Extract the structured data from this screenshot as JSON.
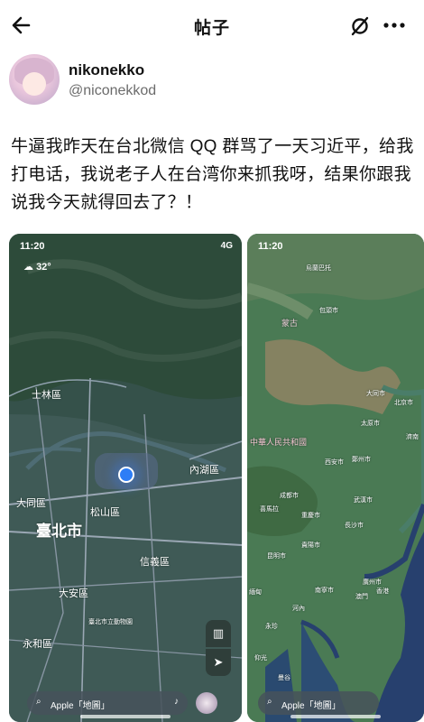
{
  "header": {
    "title": "帖子",
    "back_icon": "back-arrow-icon",
    "mute_icon": "mute-icon",
    "more_icon": "more-icon"
  },
  "author": {
    "name": "nikonekko",
    "handle": "@niconekkod"
  },
  "post": {
    "text": "牛逼我昨天在台北微信 QQ 群骂了一天习近平，给我打电话，我说老子人在台湾你来抓我呀，结果你跟我说我今天就得回去了？！"
  },
  "screenshot_left": {
    "time": "11:20",
    "network": "4G",
    "weather": "32°",
    "places": {
      "shilin": "士林區",
      "neihu": "內湖區",
      "datong": "大同區",
      "songshan": "松山區",
      "taipei": "臺北市",
      "xinyi": "信義區",
      "daan": "大安區",
      "yonghe": "永和區",
      "zoo": "臺北市立動物園"
    },
    "search": "Apple「地圖」"
  },
  "screenshot_right": {
    "time": "11:20",
    "places": {
      "ulaanbaatar": "烏蘭巴托",
      "mongolia": "蒙古",
      "baotou": "包頭市",
      "datong_city": "大同市",
      "beijing": "北京市",
      "taiyuan": "太原市",
      "jinan": "濟南",
      "prc": "中華人民共和國",
      "xian": "西安市",
      "zhengzhou": "鄭州市",
      "chengdu": "成都市",
      "wuhan": "武漢市",
      "chongqing": "重慶市",
      "changsha": "長沙市",
      "himalaya": "喜馬拉",
      "guiyang": "貴陽市",
      "kunming": "昆明市",
      "nanning": "南寧市",
      "guangzhou": "廣州市",
      "hongkong": "香港",
      "macau": "澳門",
      "myanmar": "緬甸",
      "vientiane": "永珍",
      "hanoi": "河內",
      "yangon": "仰光",
      "bangkok": "曼谷"
    },
    "search": "Apple「地圖」"
  }
}
